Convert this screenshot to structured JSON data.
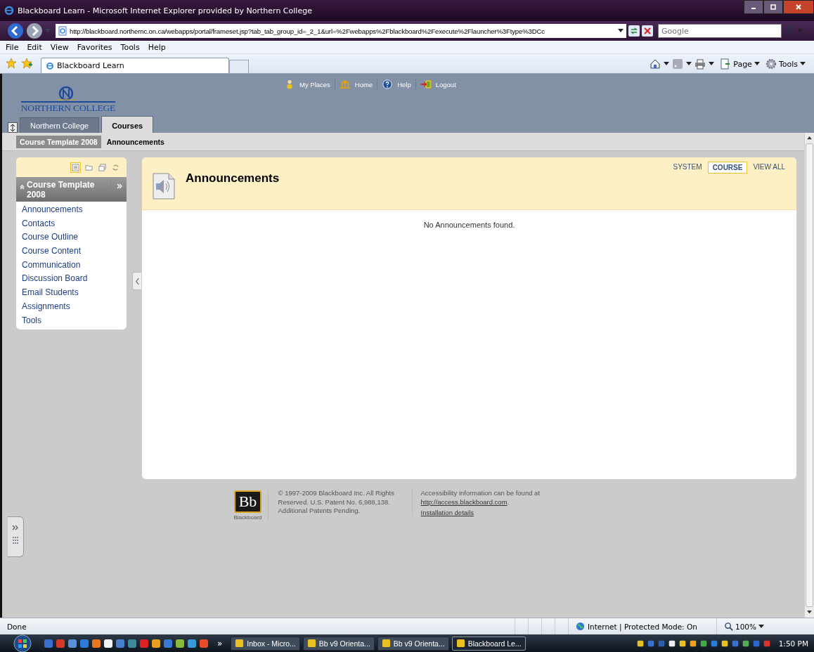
{
  "browser": {
    "title": "Blackboard Learn - Microsoft Internet Explorer provided by Northern College",
    "address": "http://blackboard.northernc.on.ca/webapps/portal/frameset.jsp?tab_tab_group_id=_2_1&url=%2Fwebapps%2Fblackboard%2Fexecute%2Flauncher%3Ftype%3DCc",
    "search_placeholder": "Google",
    "menu": [
      "File",
      "Edit",
      "View",
      "Favorites",
      "Tools",
      "Help"
    ],
    "tab": "Blackboard Learn",
    "commands": [
      {
        "label": "Page",
        "kind": "page"
      },
      {
        "label": "Tools",
        "kind": "gear"
      }
    ]
  },
  "header": {
    "logo": "NORTHERN COLLEGE",
    "links": [
      {
        "label": "My Places",
        "kind": "person"
      },
      {
        "label": "Home",
        "kind": "home"
      },
      {
        "label": "Help",
        "kind": "help"
      },
      {
        "label": "Logout",
        "kind": "logout"
      }
    ],
    "tabs": [
      {
        "label": "Northern College",
        "selected": false
      },
      {
        "label": "Courses",
        "selected": true
      }
    ]
  },
  "breadcrumbs": [
    "Course Template 2008",
    "Announcements"
  ],
  "course_menu": {
    "title": "Course Template 2008",
    "view_modes": [
      {
        "kind": "list",
        "selected": true
      },
      {
        "kind": "folder",
        "selected": false
      },
      {
        "kind": "window",
        "selected": false
      },
      {
        "kind": "refresh",
        "selected": false
      }
    ],
    "items": [
      "Announcements",
      "Contacts",
      "Course Outline",
      "Course Content",
      "Communication",
      "Discussion Board",
      "Email Students",
      "Assignments",
      "Tools"
    ]
  },
  "content": {
    "title": "Announcements",
    "filters": [
      {
        "label": "SYSTEM",
        "selected": false
      },
      {
        "label": "COURSE",
        "selected": true
      },
      {
        "label": "VIEW ALL",
        "selected": false
      }
    ],
    "empty_message": "No Announcements found."
  },
  "footer": {
    "logo": "Bb",
    "logo_caption": "Blackboard",
    "copyright": "© 1997-2009 Blackboard Inc. All Rights Reserved. U.S. Patent No. 6,988,138. Additional Patents Pending.",
    "accessibility": "Accessibility information can be found at",
    "accessibility_link": "http://access.blackboard.com",
    "accessibility_end": ".",
    "installation_link": "Installation details"
  },
  "status_bar": {
    "text": "Done",
    "zone": "Internet | Protected Mode: On",
    "zoom": "100%"
  },
  "taskbar": {
    "more": "»",
    "windows": [
      {
        "label": "Inbox - Micro...",
        "selected": false
      },
      {
        "label": "Bb v9 Orienta...",
        "selected": false
      },
      {
        "label": "Bb v9 Orienta...",
        "selected": false
      },
      {
        "label": "Blackboard Le...",
        "selected": true
      }
    ],
    "clock": "1:50 PM"
  }
}
